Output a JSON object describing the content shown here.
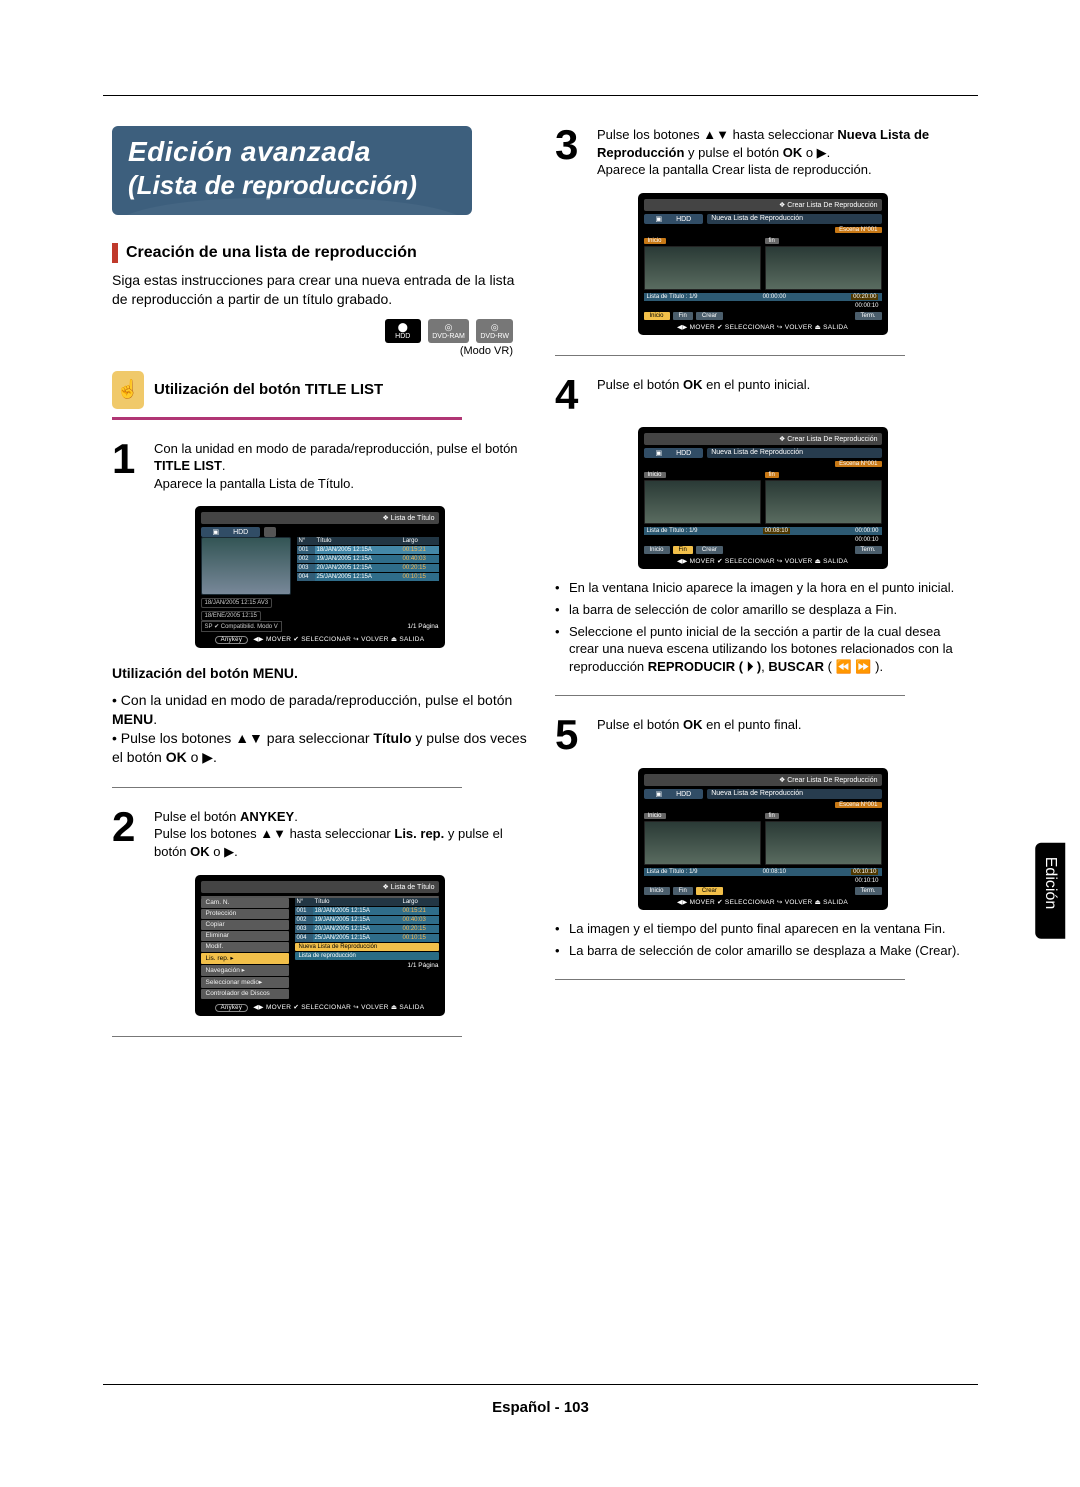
{
  "title": {
    "l1": "Edición avanzada",
    "l2": "(Lista de reproducción)"
  },
  "section": "Creación de una lista de reproducción",
  "intro": "Siga estas instrucciones para crear una nueva entrada de la lista de reproducción a partir de un título grabado.",
  "discs": {
    "hdd": "HDD",
    "ram": "DVD-RAM",
    "rw": "DVD-RW"
  },
  "mode": "(Modo VR)",
  "util_title_list": "Utilización del botón TITLE LIST",
  "util_menu": "Utilización del botón MENU.",
  "step1": {
    "a": "Con la unidad en modo de parada/reproducción, pulse el botón ",
    "b": "TITLE LIST",
    "c": ".",
    "d": "Aparece la pantalla Lista de Título."
  },
  "menu_block": {
    "a": "• Con la unidad en modo de parada/reproducción, pulse el botón ",
    "b": "MENU",
    "c": ".",
    "d": "• Pulse los botones ▲▼ para seleccionar ",
    "e": "Título",
    "f": " y pulse dos veces el botón ",
    "g": "OK",
    "h": " o ▶."
  },
  "step2": {
    "a": "Pulse el botón ",
    "b": "ANYKEY",
    "c": ".",
    "d": "Pulse los botones ▲▼ hasta seleccionar ",
    "e": "Lis. rep.",
    "f": " y pulse el botón ",
    "g": "OK",
    "h": " o ▶."
  },
  "step3": {
    "a": "Pulse los botones ▲▼ hasta seleccionar ",
    "b": "Nueva Lista de Reproducción",
    "c": " y pulse el botón ",
    "d": "OK",
    "e": " o ▶.",
    "f": "Aparece la pantalla Crear lista de reproducción."
  },
  "step4": {
    "a": "Pulse el botón ",
    "b": "OK",
    "c": " en el punto inicial."
  },
  "step4_bul": {
    "a": "En la ventana Inicio aparece la imagen y la hora en el punto inicial.",
    "b": "la barra de selección de color amarillo se desplaza a Fin.",
    "c": "Seleccione el punto inicial de la sección a partir de la cual desea crear una nueva escena utilizando los botones relacionados con la reproducción ",
    "c2": "REPRODUCIR ( ⏵ )",
    "c3": ", ",
    "c4": "BUSCAR",
    "c5": " ( ⏪ ⏩ )."
  },
  "step5": {
    "a": "Pulse el botón ",
    "b": "OK",
    "c": " en el punto final."
  },
  "step5_bul": {
    "a": "La imagen y el tiempo del punto final aparecen en la ventana Fin.",
    "b": "La barra de selección de color amarillo se desplaza a Make (Crear)."
  },
  "osd": {
    "list_title": "❖  Lista de Título",
    "create_title": "❖  Crear Lista De Reproducción",
    "new_pl": "Nueva Lista de Reproducción",
    "hdd": "HDD",
    "cols": {
      "n": "N°",
      "t": "Título",
      "l": "Largo"
    },
    "rows": [
      {
        "n": "001",
        "d": "18/JAN/2005 12:15A",
        "l": "00:15:21"
      },
      {
        "n": "002",
        "d": "19/JAN/2005 12:15A",
        "l": "00:40:03"
      },
      {
        "n": "003",
        "d": "20/JAN/2005 12:15A",
        "l": "00:20:15"
      },
      {
        "n": "004",
        "d": "25/JAN/2005 12:15A",
        "l": "00:10:15"
      }
    ],
    "status": {
      "a": "18/JAN/2005 12:15 AV3",
      "b": "18/ENE/2005 12:15",
      "c": "SP ✔ Compatibilid. Modo V"
    },
    "page": "1/1 Página",
    "foot": "◀▶ MOVER    ✔ SELECCIONAR  ↪ VOLVER     ⏏ SALIDA",
    "anykey": "Anykey",
    "ctx": {
      "items": [
        "Cam. N.",
        "Protección",
        "Copiar",
        "Eliminar",
        "Modif.",
        "Lis. rep.",
        "Navegación",
        "Seleccionar medio",
        "Controlador de Discos"
      ],
      "sub": [
        "Nueva Lista de Reproducción",
        "Lista de reproducción"
      ]
    },
    "create": {
      "scene": "Escena N°001",
      "inicio": "Inicio",
      "fin": "fin",
      "tlist": "Lista de Título :  1/9",
      "t0": "00:00:00",
      "t1": "00:00:10",
      "t2": "00:08:10",
      "t3": "00:10:10",
      "t4": "00:20:00",
      "btn": {
        "inicio": "Inicio",
        "fin": "Fin",
        "crear": "Crear",
        "term": "Term."
      }
    }
  },
  "tab": {
    "on": "Edición",
    "off": ""
  },
  "footer": {
    "lang": "Español - ",
    "page": "103"
  }
}
